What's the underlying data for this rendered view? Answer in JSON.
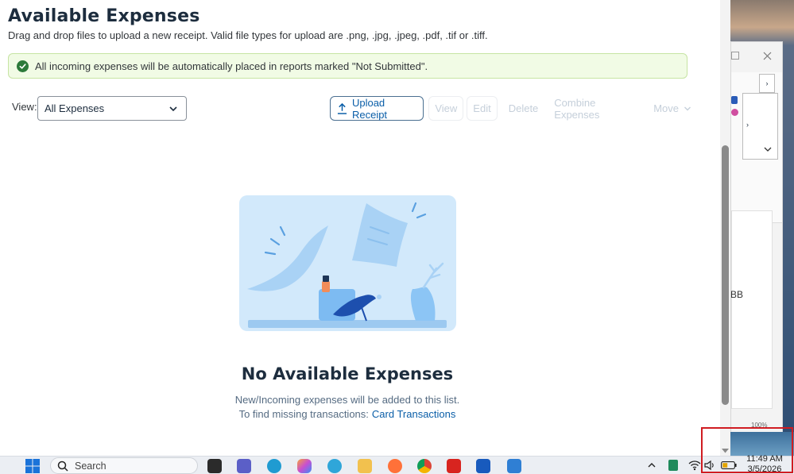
{
  "page": {
    "title": "Available Expenses",
    "subtitle": "Drag and drop files to upload a new receipt. Valid file types for upload are .png, .jpg, .jpeg, .pdf, .tif or .tiff.",
    "banner": "All incoming expenses will be automatically placed in reports marked \"Not Submitted\"."
  },
  "filter": {
    "label": "View:",
    "selected": "All Expenses"
  },
  "toolbar": {
    "upload": "Upload Receipt",
    "view": "View",
    "edit": "Edit",
    "delete": "Delete",
    "combine": "Combine Expenses",
    "move": "Move"
  },
  "empty": {
    "title": "No Available Expenses",
    "line1": "New/Incoming expenses will be added to this list.",
    "line2": "To find missing transactions:",
    "link": "Card Transactions"
  },
  "background_window": {
    "visible_text": "BB",
    "zoom": "100%"
  },
  "taskbar": {
    "search_placeholder": "Search",
    "time": "11:49 AM",
    "date": "3/5/2026"
  },
  "colors": {
    "link": "#0a5ea8",
    "success": "#2c7a3a",
    "banner_bg": "#f1fbe5",
    "illustration_bg": "#d2e9fb",
    "highlight": "#d01c22"
  },
  "icons": [
    "check-circle-icon",
    "chevron-down-icon",
    "upload-icon",
    "windows-start-icon",
    "search-icon",
    "wifi-icon",
    "volume-icon",
    "battery-icon",
    "chevron-up-icon"
  ]
}
